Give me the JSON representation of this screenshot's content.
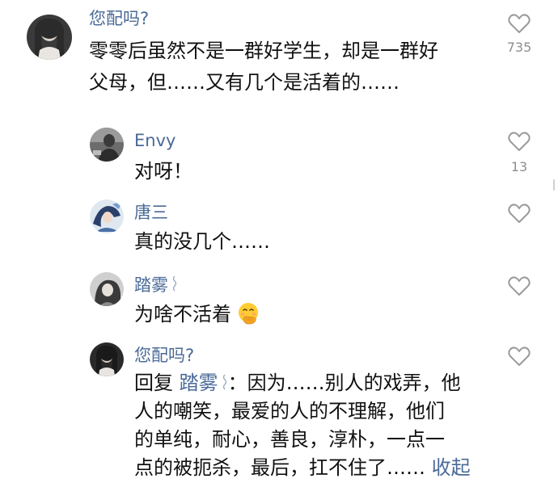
{
  "comments": [
    {
      "username": "您配吗?",
      "text_lines": [
        "零零后虽然不是一群好学生，却是一群好",
        "父母，但……又有几个是活着的……"
      ],
      "likes": "735",
      "icon": "heart-outline-icon"
    },
    {
      "username": "Envy",
      "text_lines": [
        "对呀！"
      ],
      "likes": "13",
      "icon": "heart-outline-icon"
    },
    {
      "username": "唐三",
      "text_lines": [
        "真的没几个……"
      ],
      "likes": "",
      "icon": "heart-outline-icon"
    },
    {
      "username": "踏雾",
      "text_lines": [
        "为啥不活着"
      ],
      "likes": "",
      "icon": "heart-outline-icon",
      "emoji": "face-with-hand-over-mouth"
    },
    {
      "username": "您配吗?",
      "reply_prefix": "回复",
      "reply_to": "踏雾",
      "reply_rest": "：因为……别人的戏弄，他",
      "text_lines": [
        "人的嘲笑，最爱的人的不理解，他们",
        "的单纯，耐心，善良，淳朴，一点一",
        "点的被扼杀，最后，扛不住了……"
      ],
      "collapse_label": "收起",
      "likes": "",
      "icon": "heart-outline-icon"
    }
  ]
}
